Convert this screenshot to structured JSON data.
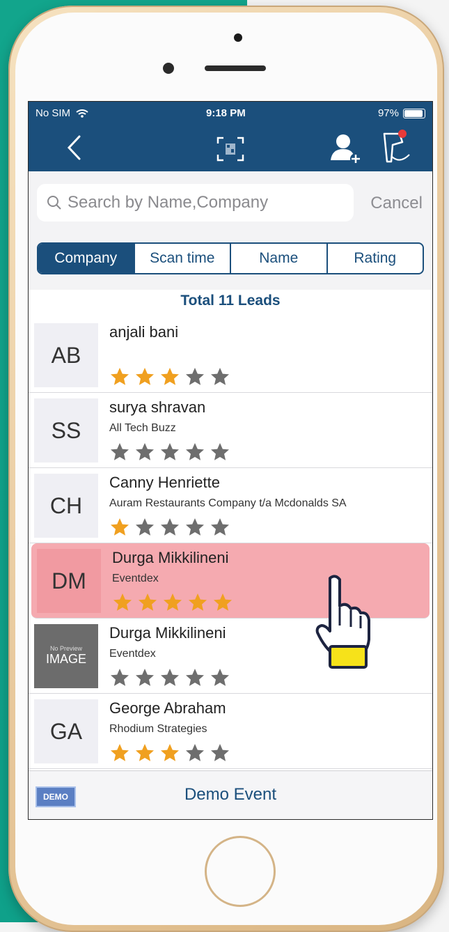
{
  "status_bar": {
    "carrier": "No SIM",
    "time": "9:18 PM",
    "battery": "97%"
  },
  "nav": {
    "back_icon": "chevron-left-icon",
    "qr_icon": "qr-scan-icon",
    "add_user_icon": "add-user-icon",
    "scanner_icon": "barcode-scanner-icon"
  },
  "search": {
    "placeholder": "Search by Name,Company",
    "value": "",
    "cancel_label": "Cancel"
  },
  "sort_tabs": [
    {
      "label": "Company",
      "active": true
    },
    {
      "label": "Scan time",
      "active": false
    },
    {
      "label": "Name",
      "active": false
    },
    {
      "label": "Rating",
      "active": false
    }
  ],
  "total_label": "Total 11 Leads",
  "leads": [
    {
      "initials": "AB",
      "name": "anjali bani",
      "company": "",
      "rating": 3
    },
    {
      "initials": "SS",
      "name": "surya shravan",
      "company": "All Tech Buzz",
      "rating": 0
    },
    {
      "initials": "CH",
      "name": "Canny Henriette",
      "company": "Auram Restaurants Company t/a Mcdonalds SA",
      "rating": 1
    },
    {
      "initials": "DM",
      "name": "Durga Mikkilineni",
      "company": "Eventdex",
      "rating": 5,
      "highlighted": true
    },
    {
      "initials": "",
      "image_placeholder": {
        "top": "No Preview",
        "bottom": "IMAGE"
      },
      "name": "Durga Mikkilineni",
      "company": "Eventdex",
      "rating": 0
    },
    {
      "initials": "GA",
      "name": "George Abraham",
      "company": "Rhodium Strategies",
      "rating": 3
    }
  ],
  "footer": {
    "badge": "DEMO",
    "event_name": "Demo Event"
  },
  "colors": {
    "nav": "#1b4f7c",
    "highlight": "#f5aab0",
    "star_on": "#f0a020",
    "star_off": "#6e6e6e"
  }
}
